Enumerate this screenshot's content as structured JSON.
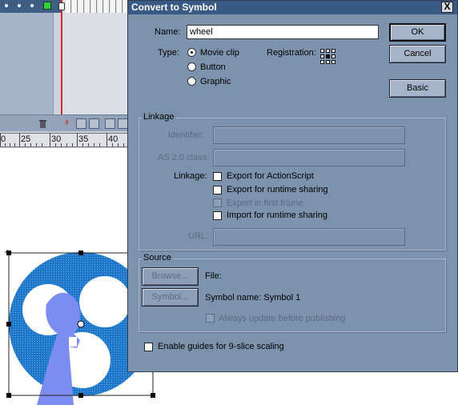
{
  "ruler": {
    "labels": [
      "0",
      "25",
      "30",
      "35",
      "40"
    ]
  },
  "dialog": {
    "title": "Convert to Symbol",
    "close_glyph": "X",
    "name_label": "Name:",
    "name_value": "wheel",
    "type_label": "Type:",
    "types": [
      {
        "label": "Movie clip",
        "selected": true
      },
      {
        "label": "Button",
        "selected": false
      },
      {
        "label": "Graphic",
        "selected": false
      }
    ],
    "registration_label": "Registration:",
    "registration_selected": "center",
    "buttons": {
      "ok": "OK",
      "cancel": "Cancel",
      "basic": "Basic"
    },
    "linkage": {
      "group_label": "Linkage",
      "identifier_label": "Identifier:",
      "as2_class_label": "AS 2.0 class:",
      "linkage_label": "Linkage:",
      "options": [
        {
          "label": "Export for ActionScript",
          "checked": false,
          "enabled": true
        },
        {
          "label": "Export for runtime sharing",
          "checked": false,
          "enabled": true
        },
        {
          "label": "Export in first frame",
          "checked": false,
          "enabled": false
        },
        {
          "label": "Import for runtime sharing",
          "checked": false,
          "enabled": true
        }
      ],
      "url_label": "URL:"
    },
    "source": {
      "group_label": "Source",
      "browse_button": "Browse...",
      "symbol_button": "Symbol...",
      "file_label": "File:",
      "symbol_name_text": "Symbol name: Symbol 1",
      "always_update_label": "Always update before publishing"
    },
    "guides_label": "Enable guides for 9-slice scaling"
  },
  "colors": {
    "dialog_bg": "#7d93ad",
    "titlebar": "#3a5a86",
    "wheel_blue": "#1c75c8",
    "figure_purple": "#7d8cf0"
  }
}
